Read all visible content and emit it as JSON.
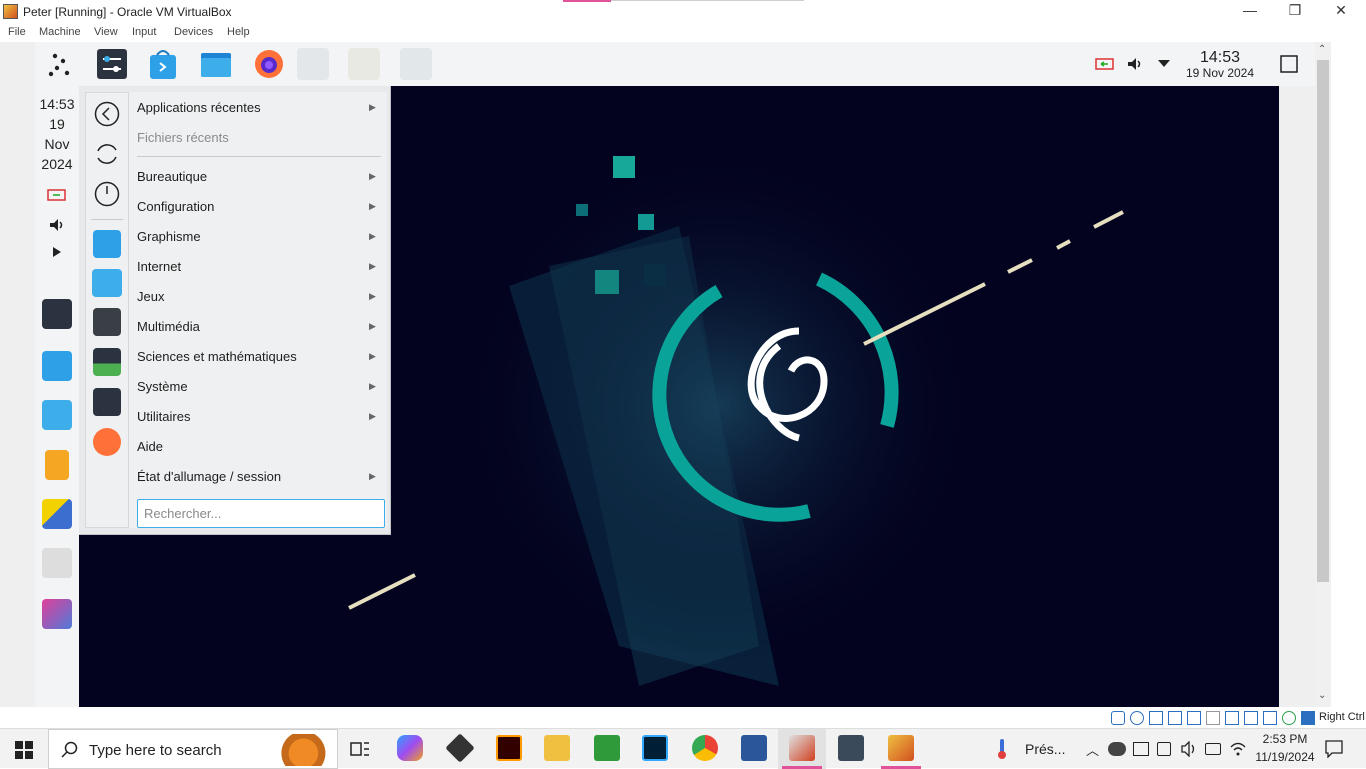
{
  "window": {
    "title": "Peter [Running] - Oracle VM VirtualBox",
    "controls": [
      "—",
      "❐",
      "✕"
    ]
  },
  "menubar": [
    "File",
    "Machine",
    "View",
    "Input",
    "Devices",
    "Help"
  ],
  "guest_top_panel": {
    "clock_time": "14:53",
    "clock_date": "19 Nov 2024"
  },
  "guest_left_panel": {
    "time": "14:53",
    "day": "19",
    "month": "Nov",
    "year": "2024"
  },
  "app_menu": {
    "items": [
      {
        "label": "Applications récentes",
        "has_submenu": true
      },
      {
        "label": "Fichiers récents",
        "disabled": true
      },
      {
        "label": "Bureautique",
        "has_submenu": true
      },
      {
        "label": "Configuration",
        "has_submenu": true
      },
      {
        "label": "Graphisme",
        "has_submenu": true
      },
      {
        "label": "Internet",
        "has_submenu": true
      },
      {
        "label": "Jeux",
        "has_submenu": true
      },
      {
        "label": "Multimédia",
        "has_submenu": true
      },
      {
        "label": "Sciences et mathématiques",
        "has_submenu": true
      },
      {
        "label": "Système",
        "has_submenu": true
      },
      {
        "label": "Utilitaires",
        "has_submenu": true
      },
      {
        "label": "Aide",
        "has_submenu": false
      },
      {
        "label": "État d'allumage / session",
        "has_submenu": true
      }
    ],
    "search_placeholder": "Rechercher..."
  },
  "statusbar": {
    "host_key": "Right Ctrl"
  },
  "taskbar": {
    "search_text": "Type here to search",
    "weather_text": "Prés...",
    "time": "2:53 PM",
    "date": "11/19/2024"
  },
  "colors": {
    "wallpaper_bg": "#03031f",
    "teal_accent": "#0aa39a",
    "kde_highlight": "#3daee9"
  }
}
